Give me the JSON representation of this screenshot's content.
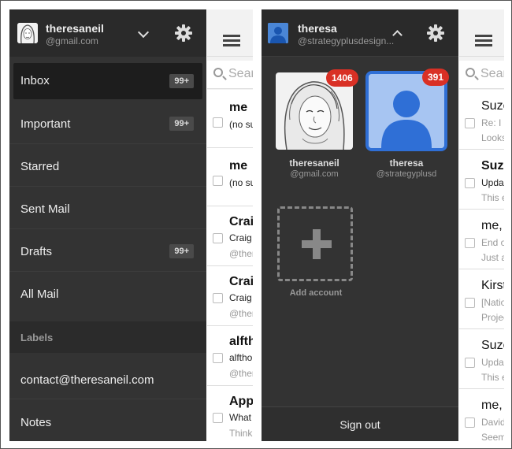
{
  "left_screen": {
    "account": {
      "name": "theresaneil",
      "email": "@gmail.com"
    },
    "nav": [
      {
        "label": "Inbox",
        "count": "99+"
      },
      {
        "label": "Important",
        "count": "99+"
      },
      {
        "label": "Starred",
        "count": ""
      },
      {
        "label": "Sent Mail",
        "count": ""
      },
      {
        "label": "Drafts",
        "count": "99+"
      },
      {
        "label": "All Mail",
        "count": ""
      }
    ],
    "labels_header": "Labels",
    "labels": [
      {
        "label": "contact@theresaneil.com"
      },
      {
        "label": "Notes"
      }
    ],
    "search_placeholder": "Sear",
    "mail": [
      {
        "from": "me",
        "line2": "(no su",
        "line3": ""
      },
      {
        "from": "me",
        "line2": "(no su",
        "line3": ""
      },
      {
        "from": "Crai",
        "line2": "Craig",
        "line3": "@ther"
      },
      {
        "from": "Crai",
        "line2": "Craig",
        "line3": "@ther"
      },
      {
        "from": "alfth",
        "line2": "alftho",
        "line3": "@ther"
      },
      {
        "from": "App",
        "line2": "What",
        "line3": "Think"
      }
    ]
  },
  "right_screen": {
    "account": {
      "name": "theresa",
      "email": "@strategyplusdesign..."
    },
    "accounts": [
      {
        "name": "theresaneil",
        "email": "@gmail.com",
        "badge": "1406"
      },
      {
        "name": "theresa",
        "email": "@strategyplusd",
        "badge": "391"
      }
    ],
    "add_account": "Add account",
    "sign_out": "Sign out",
    "search_placeholder": "Sear",
    "mail": [
      {
        "from": "Suze",
        "line2": "Re: I c",
        "line3": "Looks",
        "bold": false
      },
      {
        "from": "Suze",
        "line2": "Upda",
        "line3": "This e",
        "bold": true
      },
      {
        "from": "me,",
        "line2": "End o",
        "line3": "Just a",
        "bold": false
      },
      {
        "from": "Kirst",
        "line2": "[Natio",
        "line3": "Projec",
        "bold": false
      },
      {
        "from": "Suze",
        "line2": "Upda",
        "line3": "This e",
        "bold": false
      },
      {
        "from": "me,",
        "line2": "David",
        "line3": "Seem",
        "bold": false
      }
    ]
  },
  "colors": {
    "drawer_bg": "#333333",
    "badge_red": "#d93025",
    "account_blue": "#4a86d6"
  },
  "icons": [
    "settings-gear-icon",
    "chevron-down-icon",
    "chevron-up-icon",
    "menu-icon",
    "search-icon",
    "plus-icon",
    "person-icon"
  ]
}
